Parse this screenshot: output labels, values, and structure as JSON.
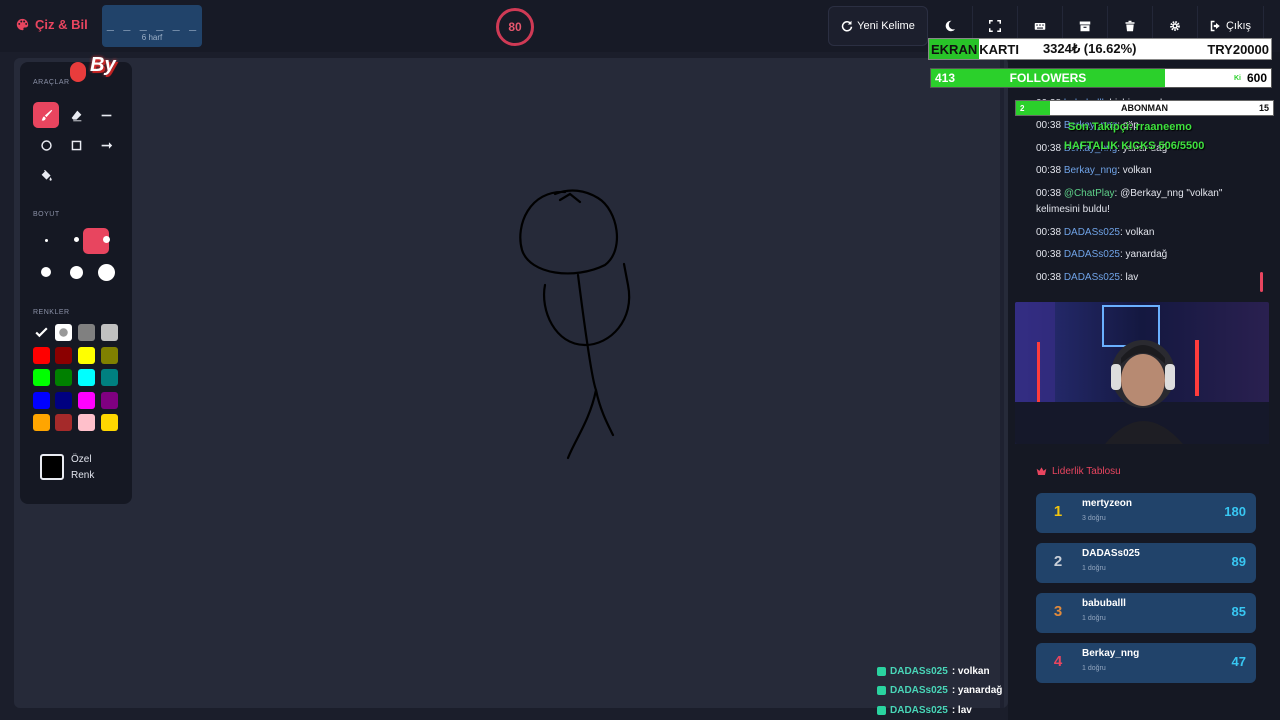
{
  "app": {
    "title": "Çiz & Bil"
  },
  "word": {
    "dashes": "_ _ _ _ _ _",
    "letter_count": "6 harf"
  },
  "timer": {
    "value": "80"
  },
  "actions": {
    "new_word": "Yeni Kelime",
    "exit": "Çıkış"
  },
  "tools": {
    "section_tools": "ARAÇLAR",
    "section_size": "BOYUT",
    "section_colors": "RENKLER",
    "custom_color_line1": "Özel",
    "custom_color_line2": "Renk",
    "colors": [
      "#000000",
      "#ffffff",
      "#808080",
      "#c0c0c0",
      "#ff0000",
      "#8b0000",
      "#ffff00",
      "#808000",
      "#00ff00",
      "#008000",
      "#00ffff",
      "#008080",
      "#0000ff",
      "#000080",
      "#ff00ff",
      "#800080",
      "#ffa500",
      "#a52a2a",
      "#ffc0cb",
      "#ffd700"
    ]
  },
  "overlays": {
    "ekran_green": "EKRAN",
    "ekran_rest": "KARTI",
    "ekran_value": "3324₺ (16.62%)",
    "ekran_target": "TRY20000",
    "followers_current": "413",
    "followers_label": "FOLLOWERS",
    "followers_target": "600",
    "followers_fill": 0.688,
    "followers_mini": "Ki",
    "abone_current": "2",
    "abone_label": "ABONMAN",
    "abone_target": "15",
    "abone_fill": 0.133,
    "son_takipci": "Son Takipçi: rraaneemo",
    "haftalik": "HAFTALIK KICKS 506/5500"
  },
  "chat": [
    {
      "time": "00:38",
      "user": "babuballl",
      "text": ": hiçbir şey olamaz"
    },
    {
      "time": "00:38",
      "user": "Berkay_nng",
      "text": ": çöp"
    },
    {
      "time": "00:38",
      "user": "Berkay_nng",
      "text": ": yanar dağ"
    },
    {
      "time": "00:38",
      "user": "Berkay_nng",
      "text": ": volkan"
    },
    {
      "time": "00:38",
      "user": "@ChatPlay",
      "text": ": @Berkay_nng \"volkan\" kelimesini buldu!"
    },
    {
      "time": "00:38",
      "user": "DADASs025",
      "text": ": volkan"
    },
    {
      "time": "00:38",
      "user": "DADASs025",
      "text": ": yanardağ"
    },
    {
      "time": "00:38",
      "user": "DADASs025",
      "text": ": lav"
    }
  ],
  "leaderboard": {
    "title": "Liderlik Tablosu",
    "rows": [
      {
        "rank": "1",
        "name": "mertyzeon",
        "sub": "3 doğru",
        "score": "180",
        "color": "#f1c40f"
      },
      {
        "rank": "2",
        "name": "DADASs025",
        "sub": "1 doğru",
        "score": "89",
        "color": "#c9cfd8"
      },
      {
        "rank": "3",
        "name": "babuballl",
        "sub": "1 doğru",
        "score": "85",
        "color": "#e08a3c"
      },
      {
        "rank": "4",
        "name": "Berkay_nng",
        "sub": "1 doğru",
        "score": "47",
        "color": "#e8455f"
      }
    ]
  },
  "bottom_chat": [
    {
      "user": "DADASs025",
      "text": " : volkan"
    },
    {
      "user": "DADASs025",
      "text": " : yanardağ"
    },
    {
      "user": "DADASs025",
      "text": " : lav"
    }
  ],
  "badge": {
    "text": "By"
  }
}
